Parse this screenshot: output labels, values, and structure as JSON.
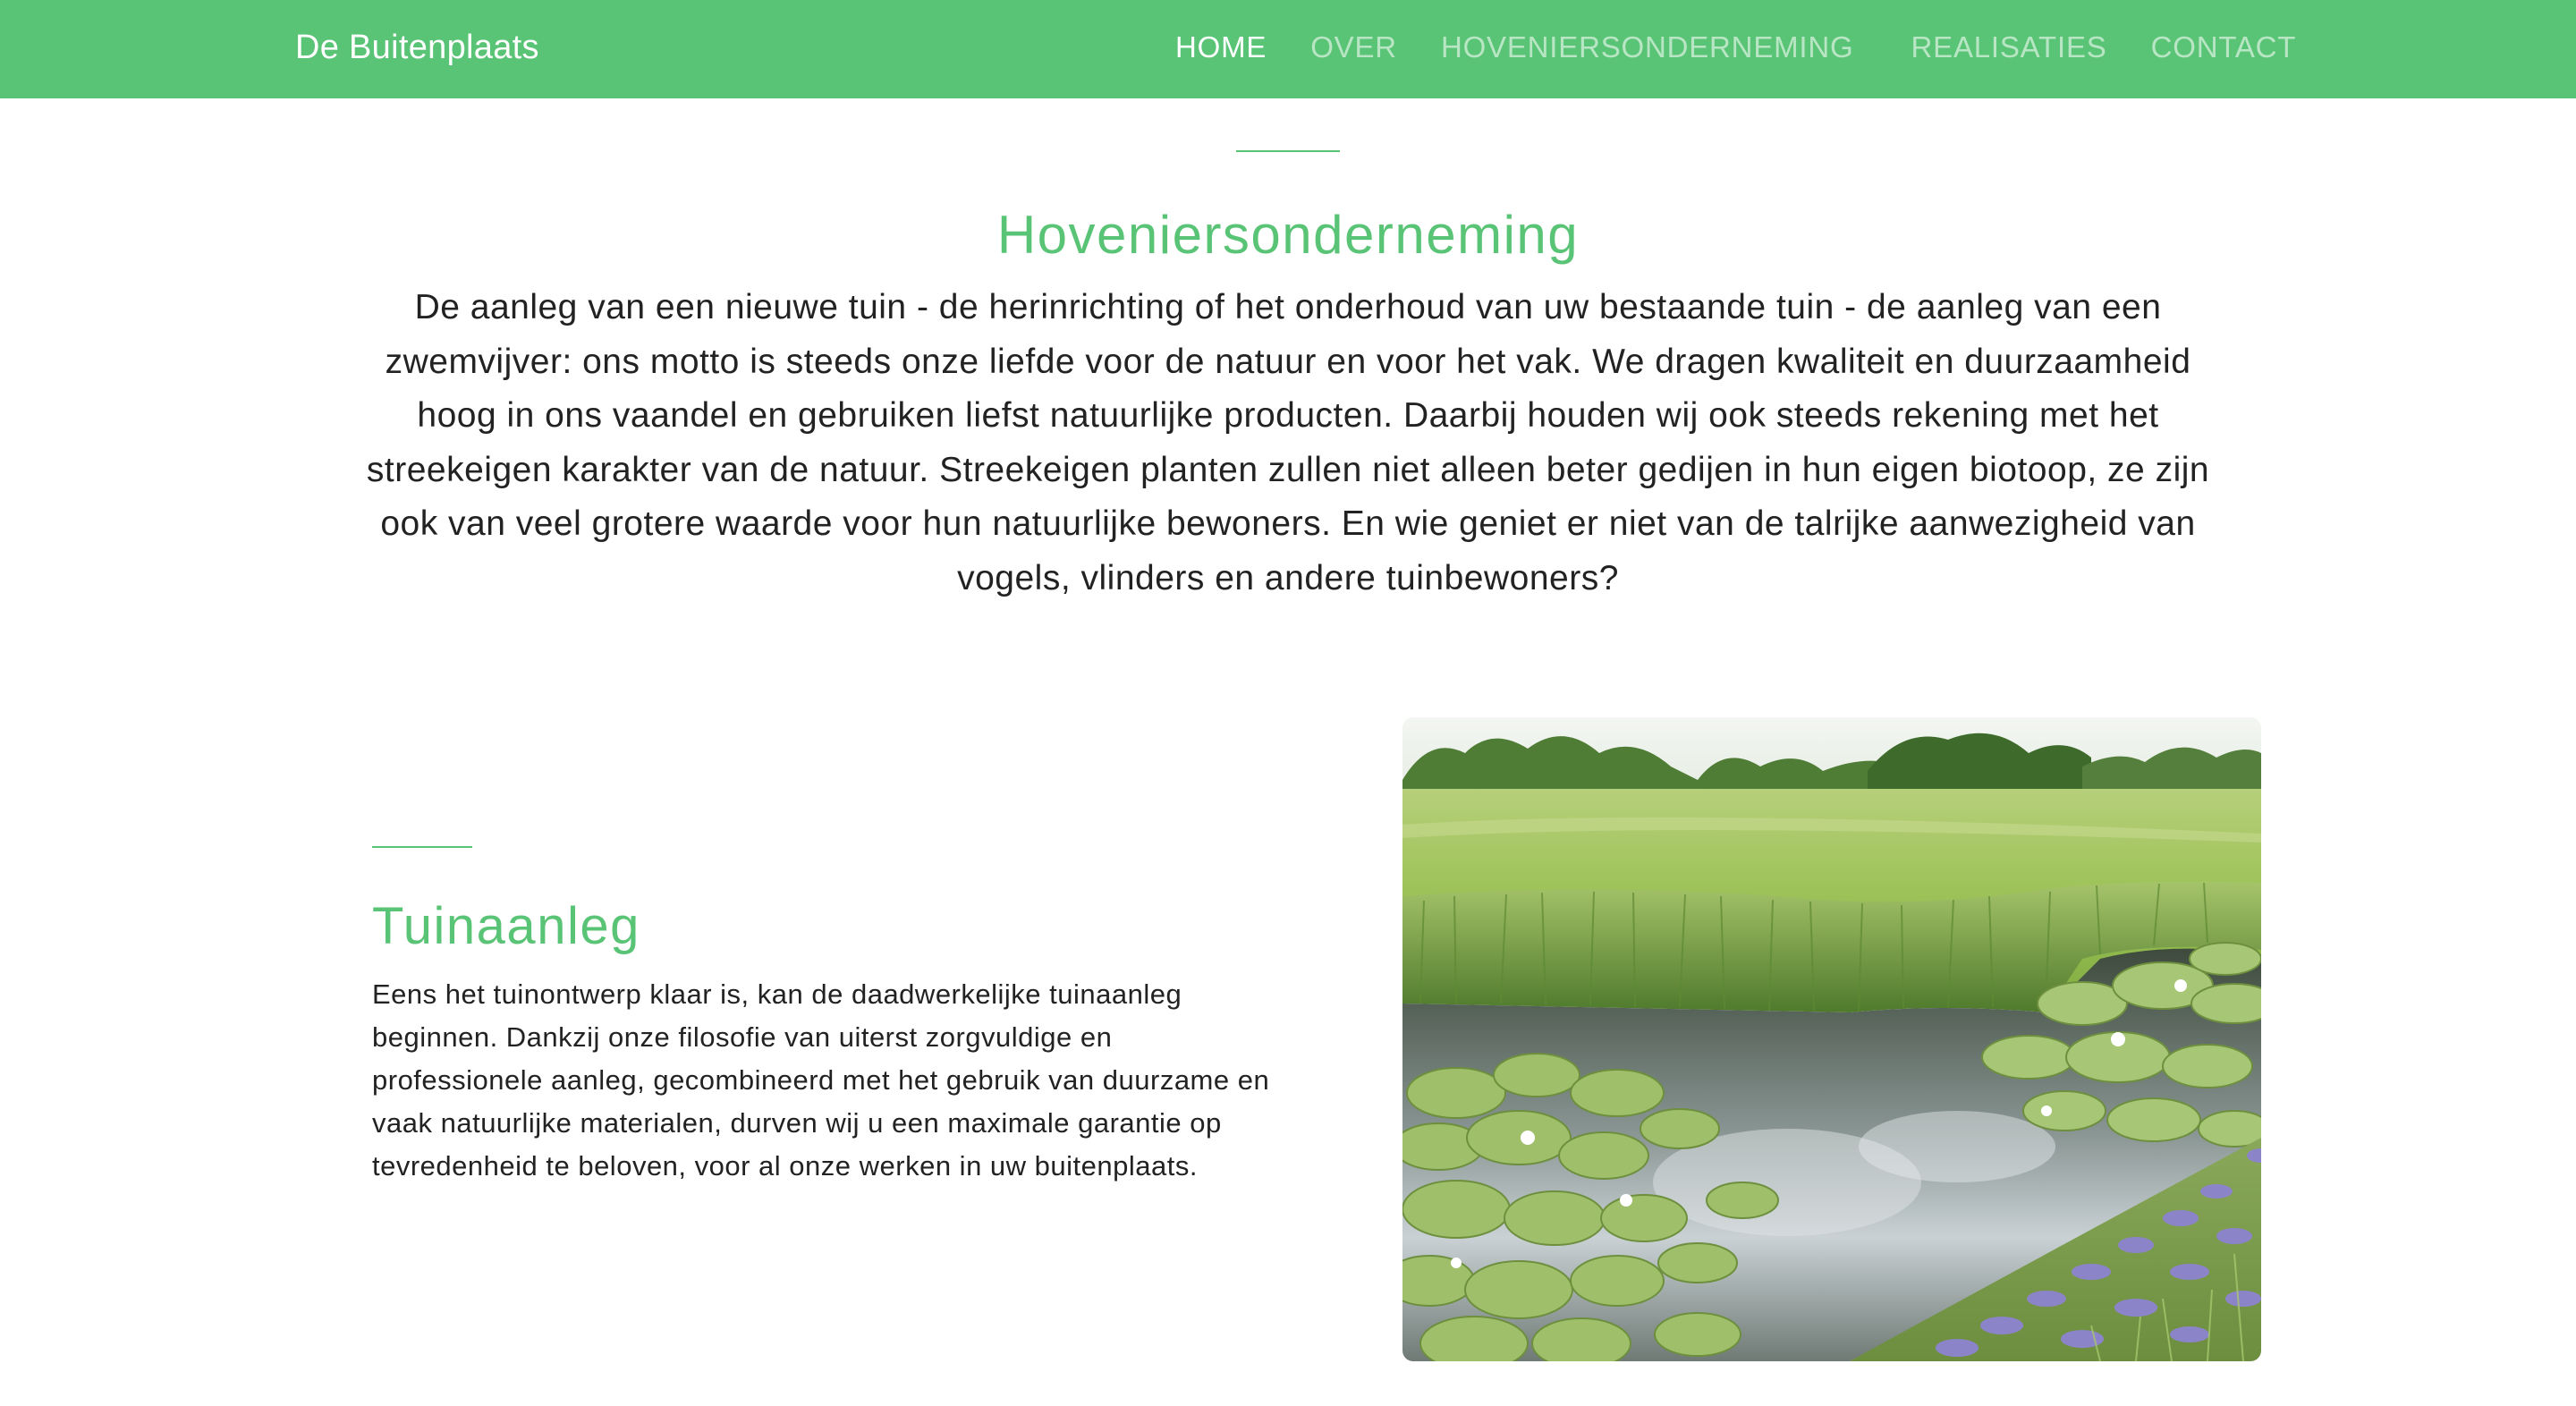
{
  "navbar": {
    "brand": "De Buitenplaats",
    "links": [
      {
        "label": "HOME",
        "active": true
      },
      {
        "label": "OVER",
        "active": false
      },
      {
        "label": "HOVENIERSONDERNEMING",
        "active": false
      },
      {
        "label": "REALISATIES",
        "active": false
      },
      {
        "label": "CONTACT",
        "active": false
      }
    ]
  },
  "intro": {
    "title": "Hoveniersonderneming",
    "text": "De aanleg van een nieuwe tuin - de herinrichting of het onderhoud van uw bestaande tuin - de aanleg van een zwemvijver: ons motto is steeds onze liefde voor de natuur en voor het vak. We dragen kwaliteit en duurzaamheid hoog in ons vaandel en gebruiken liefst natuurlijke producten. Daarbij houden wij ook steeds rekening met het streekeigen karakter van de natuur. Streekeigen planten zullen niet alleen beter gedijen in hun eigen biotoop, ze zijn ook van veel grotere waarde voor hun natuurlijke bewoners. En wie geniet er niet van de talrijke aanwezigheid van vogels, vlinders en andere tuinbewoners?"
  },
  "feature": {
    "title": "Tuinaanleg",
    "text": "Eens het tuinontwerp klaar is, kan de daadwerkelijke tuinaanleg beginnen. Dankzij onze filosofie van uiterst zorgvuldige en professionele aanleg, gecombineerd met het gebruik van duurzame en vaak natuurlijke materialen, durven wij u een maximale garantie op tevredenheid te beloven, voor al onze werken in uw buitenplaats."
  },
  "colors": {
    "brand_green": "#5ac476",
    "nav_inactive": "#b8e6c4",
    "text": "#222222"
  }
}
